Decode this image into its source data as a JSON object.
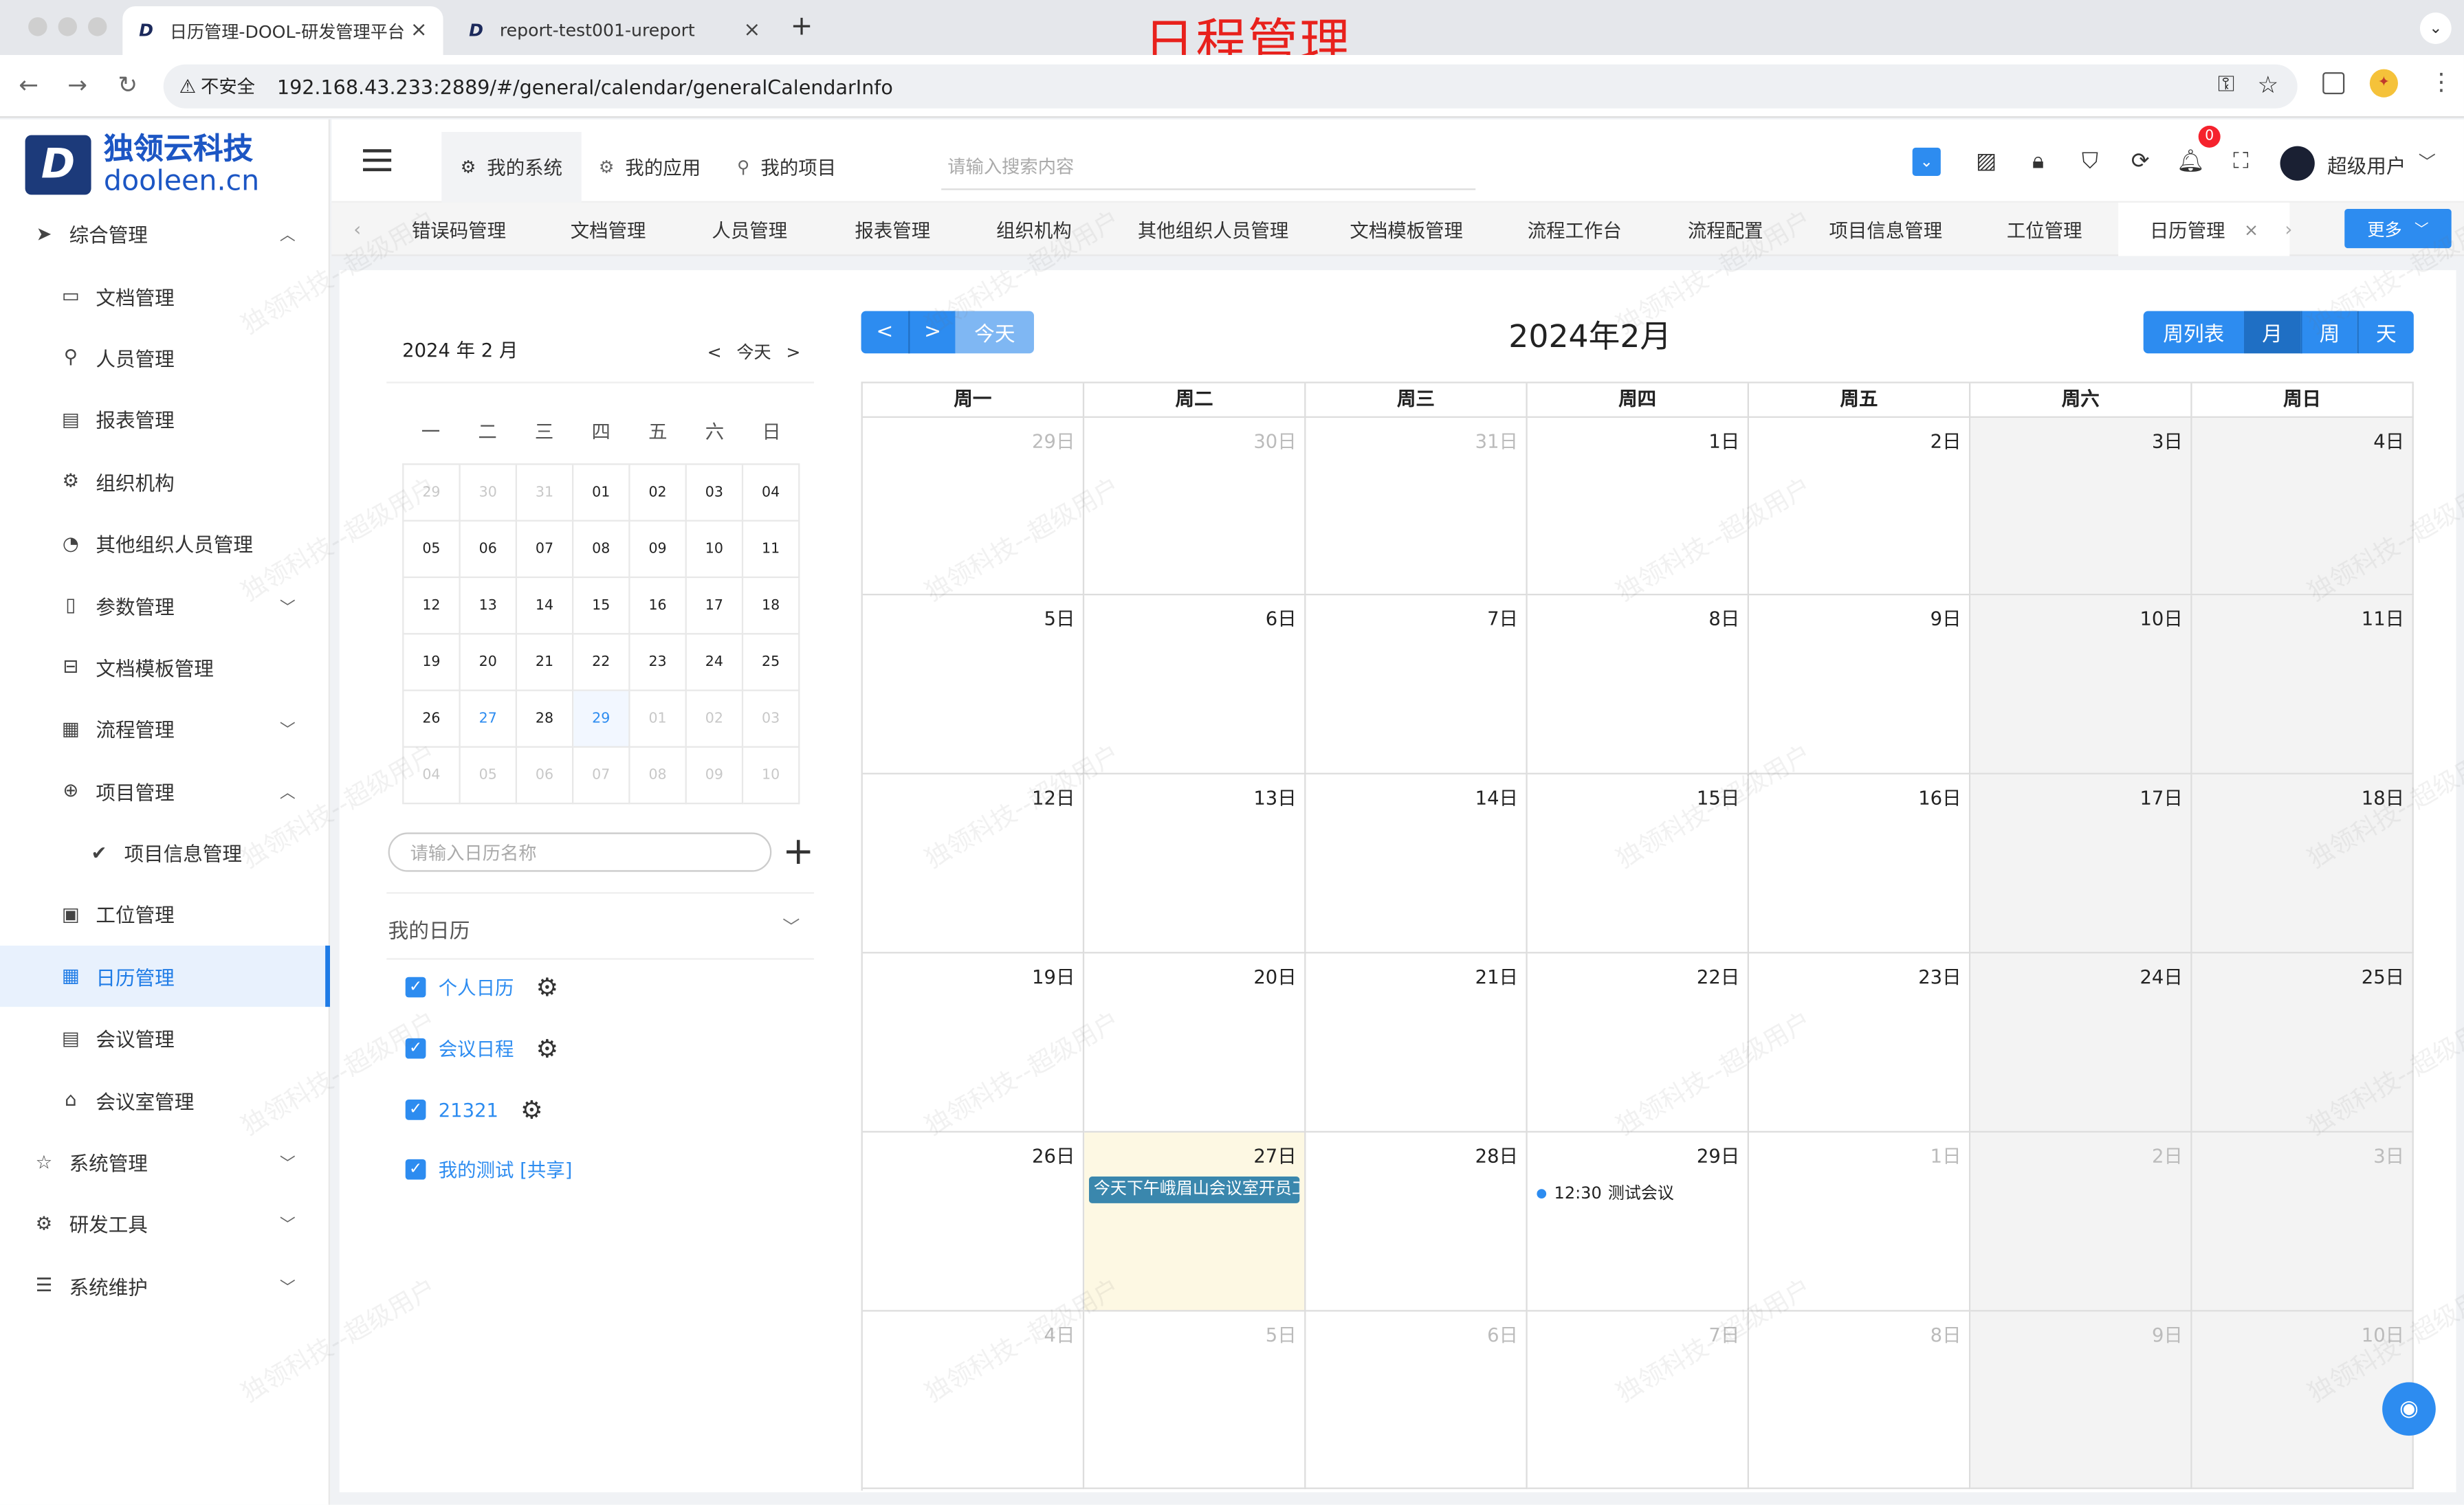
{
  "browser": {
    "tabs": [
      {
        "title": "日历管理-DOOL-研发管理平台",
        "close": "×"
      },
      {
        "title": "report-test001-ureport",
        "close": "×"
      }
    ],
    "new_tab": "+",
    "security_label": "不安全",
    "url": "192.168.43.233:2889/#/general/calendar/generalCalendarInfo"
  },
  "overlay_title": "日程管理",
  "brand": {
    "name": "独领云科技",
    "domain": "dooleen.cn"
  },
  "sidebar": {
    "items": [
      {
        "label": "综合管理",
        "icon": "send-icon"
      },
      {
        "label": "文档管理",
        "icon": "folder-icon"
      },
      {
        "label": "人员管理",
        "icon": "user-icon"
      },
      {
        "label": "报表管理",
        "icon": "report-icon"
      },
      {
        "label": "组织机构",
        "icon": "gear-icon"
      },
      {
        "label": "其他组织人员管理",
        "icon": "chart-icon"
      },
      {
        "label": "参数管理",
        "icon": "book-icon"
      },
      {
        "label": "文档模板管理",
        "icon": "template-icon"
      },
      {
        "label": "流程管理",
        "icon": "calendar-grid-icon"
      },
      {
        "label": "项目管理",
        "icon": "plus-circle-icon"
      },
      {
        "label": "项目信息管理",
        "icon": "check-circle-icon"
      },
      {
        "label": "工位管理",
        "icon": "clipboard-icon"
      },
      {
        "label": "日历管理",
        "icon": "calendar-icon"
      },
      {
        "label": "会议管理",
        "icon": "document-icon"
      },
      {
        "label": "会议室管理",
        "icon": "home-icon"
      },
      {
        "label": "系统管理",
        "icon": "star-icon"
      },
      {
        "label": "研发工具",
        "icon": "gear-icon"
      },
      {
        "label": "系统维护",
        "icon": "sliders-icon"
      }
    ]
  },
  "header": {
    "tabs": [
      {
        "label": "我的系统"
      },
      {
        "label": "我的应用"
      },
      {
        "label": "我的项目"
      }
    ],
    "search_placeholder": "请输入搜索内容",
    "notification_count": "0",
    "user_name": "超级用户"
  },
  "page_tabs": {
    "items": [
      "错误码管理",
      "文档管理",
      "人员管理",
      "报表管理",
      "组织机构",
      "其他组织人员管理",
      "文档模板管理",
      "流程工作台",
      "流程配置",
      "项目信息管理",
      "工位管理",
      "日历管理"
    ],
    "close": "×",
    "more_label": "更多"
  },
  "mini_calendar": {
    "title": "2024 年 2 月",
    "prev": "<",
    "today": "今天",
    "next": ">",
    "weekdays": [
      "一",
      "二",
      "三",
      "四",
      "五",
      "六",
      "日"
    ],
    "days": [
      [
        "29",
        "30",
        "31",
        "01",
        "02",
        "03",
        "04"
      ],
      [
        "05",
        "06",
        "07",
        "08",
        "09",
        "10",
        "11"
      ],
      [
        "12",
        "13",
        "14",
        "15",
        "16",
        "17",
        "18"
      ],
      [
        "19",
        "20",
        "21",
        "22",
        "23",
        "24",
        "25"
      ],
      [
        "26",
        "27",
        "28",
        "29",
        "01",
        "02",
        "03"
      ],
      [
        "04",
        "05",
        "06",
        "07",
        "08",
        "09",
        "10"
      ]
    ],
    "search_placeholder": "请输入日历名称",
    "add": "+",
    "my_calendars_label": "我的日历",
    "calendars": [
      "个人日历",
      "会议日程",
      "21321",
      "我的测试 [共享]"
    ]
  },
  "calendar": {
    "prev": "<",
    "next": ">",
    "today": "今天",
    "title": "2024年2月",
    "views": [
      "周列表",
      "月",
      "周",
      "天"
    ],
    "weekdays": [
      "周一",
      "周二",
      "周三",
      "周四",
      "周五",
      "周六",
      "周日"
    ],
    "weeks": [
      [
        "29日",
        "30日",
        "31日",
        "1日",
        "2日",
        "3日",
        "4日"
      ],
      [
        "5日",
        "6日",
        "7日",
        "8日",
        "9日",
        "10日",
        "11日"
      ],
      [
        "12日",
        "13日",
        "14日",
        "15日",
        "16日",
        "17日",
        "18日"
      ],
      [
        "19日",
        "20日",
        "21日",
        "22日",
        "23日",
        "24日",
        "25日"
      ],
      [
        "26日",
        "27日",
        "28日",
        "29日",
        "1日",
        "2日",
        "3日"
      ],
      [
        "4日",
        "5日",
        "6日",
        "7日",
        "8日",
        "9日",
        "10日"
      ]
    ],
    "events": [
      {
        "day": "27日",
        "title": "今天下午峨眉山会议室开员工"
      },
      {
        "day": "29日",
        "time": "12:30",
        "title": "测试会议"
      }
    ]
  },
  "watermark": "独领科技--超级用户",
  "colors": {
    "accent": "#2d8cf0",
    "today_bg": "#fdf8e3",
    "weekend_bg": "#f3f3f3",
    "overlay_red": "#e8211c"
  }
}
